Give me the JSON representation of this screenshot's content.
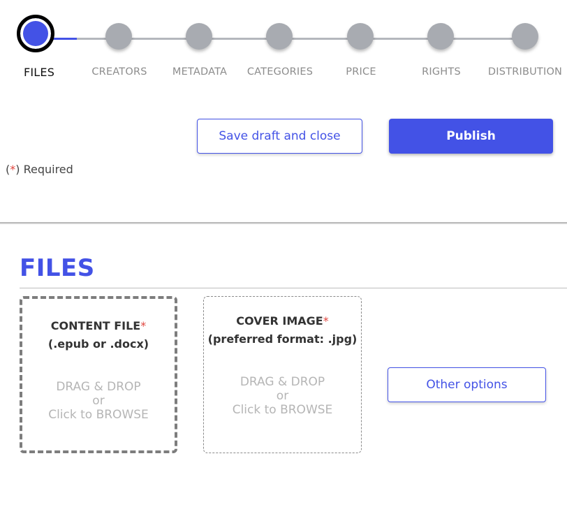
{
  "stepper": {
    "steps": [
      {
        "label": "FILES",
        "current": true
      },
      {
        "label": "CREATORS",
        "current": false
      },
      {
        "label": "METADATA",
        "current": false
      },
      {
        "label": "CATEGORIES",
        "current": false
      },
      {
        "label": "PRICE",
        "current": false
      },
      {
        "label": "RIGHTS",
        "current": false
      },
      {
        "label": "DISTRIBUTION",
        "current": false
      }
    ]
  },
  "actions": {
    "save_label": "Save draft and close",
    "publish_label": "Publish"
  },
  "required_note": {
    "open": "(",
    "star": "*",
    "close": ") Required"
  },
  "files": {
    "title": "FILES",
    "content": {
      "title": "CONTENT FILE",
      "star": "*",
      "formats": "(.epub or .docx)",
      "hint_line1": "DRAG & DROP",
      "hint_line2": "or",
      "hint_line3": "Click to BROWSE"
    },
    "cover": {
      "title": "COVER IMAGE",
      "star": "*",
      "formats": "(preferred format: .jpg)",
      "hint_line1": "DRAG & DROP",
      "hint_line2": "or",
      "hint_line3": "Click to BROWSE"
    },
    "other_options_label": "Other options"
  },
  "colors": {
    "accent": "#4352e6",
    "inactive_step": "#a8abb1",
    "required": "#e0453e"
  }
}
